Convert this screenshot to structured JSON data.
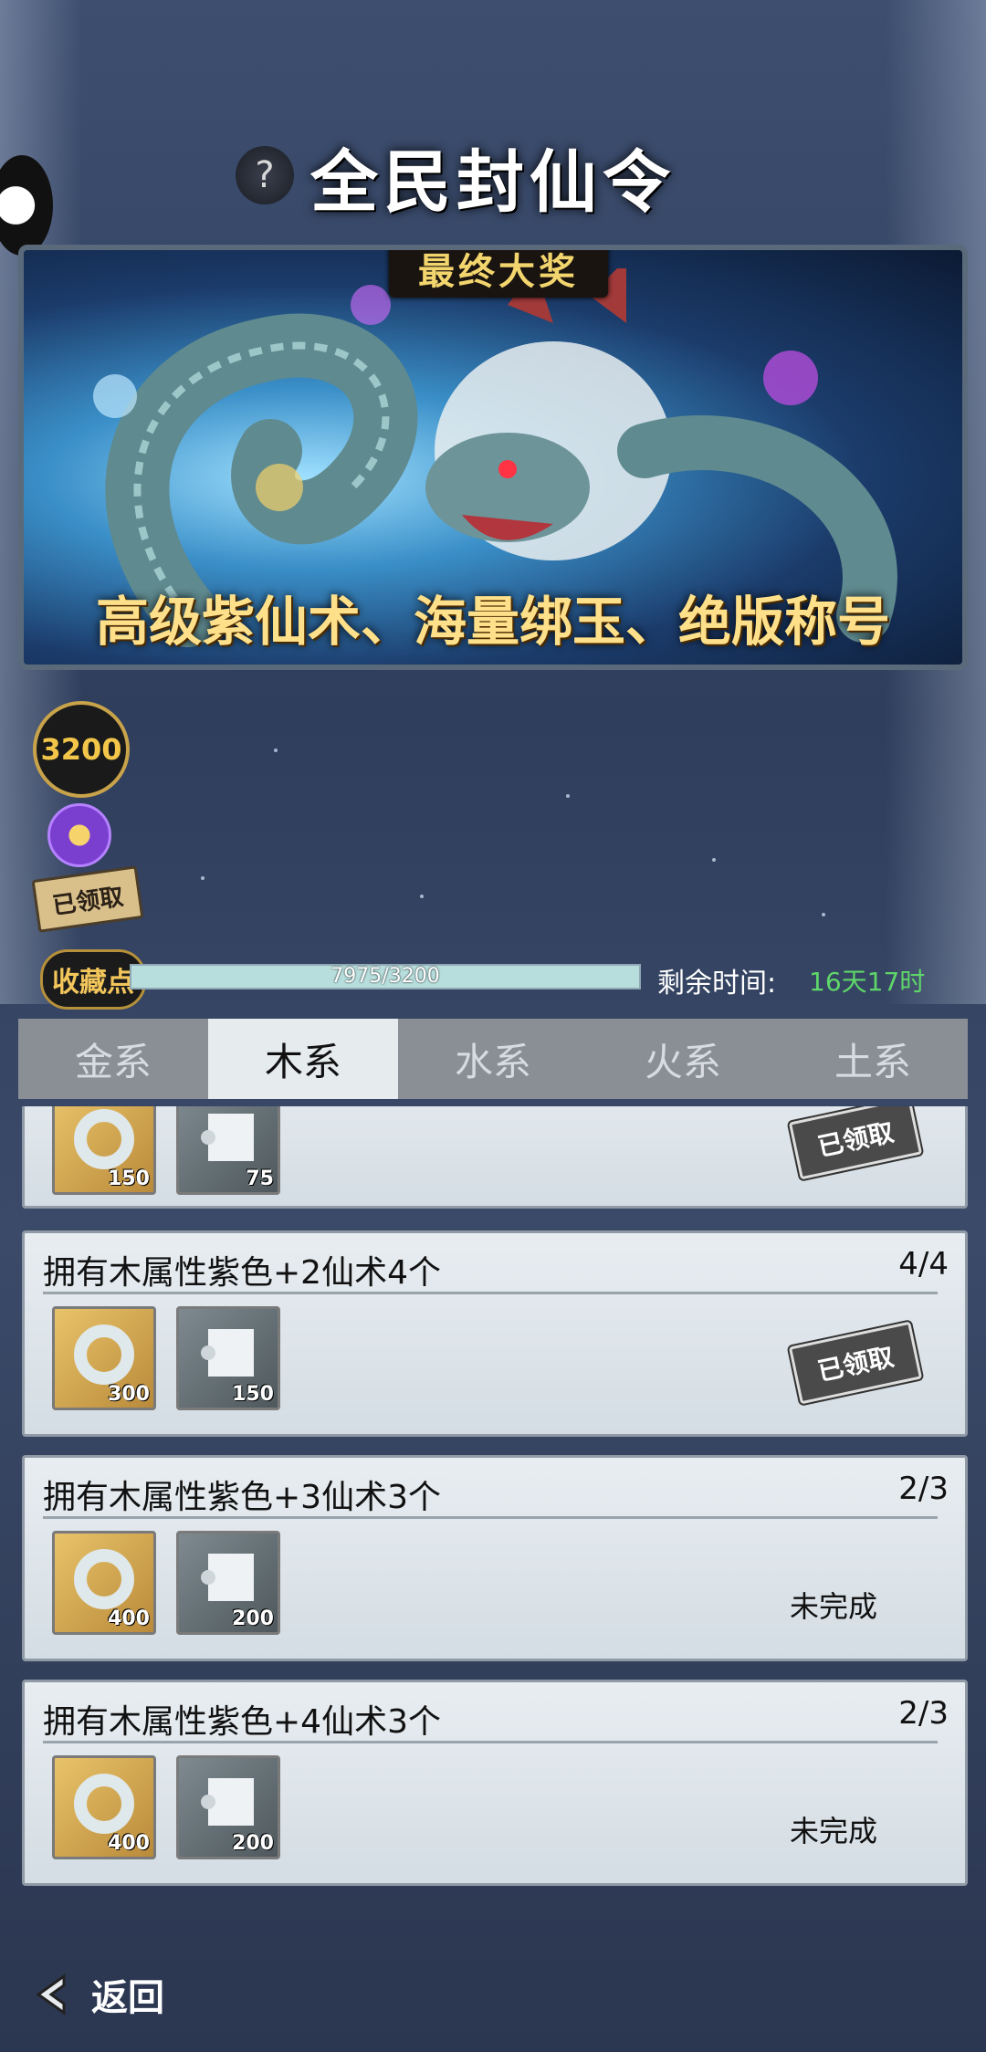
{
  "header": {
    "title": "全民封仙令",
    "help_icon": "?"
  },
  "banner": {
    "badge": "最终大奖",
    "caption": "高级紫仙术、海量绑玉、绝版称号"
  },
  "rail": {
    "score": "3200",
    "claimed_label": "已领取"
  },
  "progress": {
    "label": "收藏点",
    "text": "7975/3200",
    "fraction": 1.0,
    "remain_label": "剩余时间:",
    "remain_value": "16天17时"
  },
  "tabs": [
    {
      "label": "金系",
      "active": false
    },
    {
      "label": "木系",
      "active": true
    },
    {
      "label": "水系",
      "active": false
    },
    {
      "label": "火系",
      "active": false
    },
    {
      "label": "土系",
      "active": false
    }
  ],
  "tasks": [
    {
      "title": "",
      "count": "",
      "ring_qty": "150",
      "scroll_qty": "75",
      "status": "已领取",
      "claimed": true
    },
    {
      "title": "拥有木属性紫色+2仙术4个",
      "count": "4/4",
      "ring_qty": "300",
      "scroll_qty": "150",
      "status": "已领取",
      "claimed": true
    },
    {
      "title": "拥有木属性紫色+3仙术3个",
      "count": "2/3",
      "ring_qty": "400",
      "scroll_qty": "200",
      "status": "未完成",
      "claimed": false
    },
    {
      "title": "拥有木属性紫色+4仙术3个",
      "count": "2/3",
      "ring_qty": "400",
      "scroll_qty": "200",
      "status": "未完成",
      "claimed": false
    }
  ],
  "back": {
    "label": "返回"
  },
  "colors": {
    "accent_gold": "#f3c64a",
    "remain_green": "#5fd66a",
    "tab_active": "#e6ebee"
  }
}
